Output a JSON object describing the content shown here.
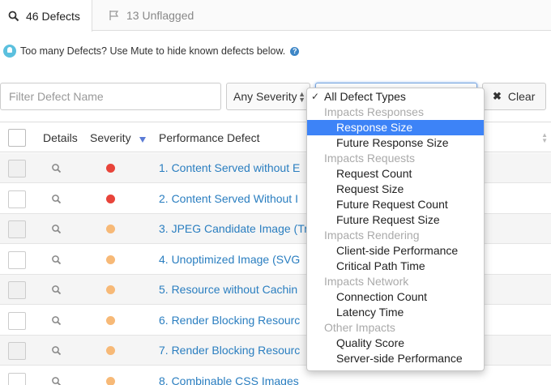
{
  "tabs": {
    "defects_label": "46 Defects",
    "unflagged_label": "13 Unflagged"
  },
  "info": {
    "message": "Too many Defects? Use Mute to hide known defects below.",
    "help_glyph": "?"
  },
  "filters": {
    "name_placeholder": "Filter Defect Name",
    "severity_value": "Any Severity",
    "clear_label": "Clear"
  },
  "table": {
    "headers": {
      "details": "Details",
      "severity": "Severity",
      "defect": "Performance Defect"
    },
    "rows": [
      {
        "name": "1.  Content Served without E",
        "severity_color": "#e8443a"
      },
      {
        "name": "2.  Content Served Without I",
        "severity_color": "#e8443a"
      },
      {
        "name": "3.  JPEG Candidate Image (Tr",
        "severity_color": "#f7b977"
      },
      {
        "name": "4.  Unoptimized Image (SVG",
        "severity_color": "#f7b977"
      },
      {
        "name": "5.  Resource without Cachin",
        "severity_color": "#f7b977"
      },
      {
        "name": "6.  Render Blocking Resourc",
        "severity_color": "#f7b977"
      },
      {
        "name": "7.  Render Blocking Resourc",
        "severity_color": "#f7b977"
      },
      {
        "name": "8.  Combinable CSS Images",
        "severity_color": "#f7b977"
      }
    ]
  },
  "dropdown": {
    "items": [
      {
        "kind": "selected",
        "label": "All Defect Types"
      },
      {
        "kind": "group",
        "label": "Impacts Responses"
      },
      {
        "kind": "option",
        "label": "Response Size",
        "highlighted": true
      },
      {
        "kind": "option",
        "label": "Future Response Size"
      },
      {
        "kind": "group",
        "label": "Impacts Requests"
      },
      {
        "kind": "option",
        "label": "Request Count"
      },
      {
        "kind": "option",
        "label": "Request Size"
      },
      {
        "kind": "option",
        "label": "Future Request Count"
      },
      {
        "kind": "option",
        "label": "Future Request Size"
      },
      {
        "kind": "group",
        "label": "Impacts Rendering"
      },
      {
        "kind": "option",
        "label": "Client-side Performance"
      },
      {
        "kind": "option",
        "label": "Critical Path Time"
      },
      {
        "kind": "group",
        "label": "Impacts Network"
      },
      {
        "kind": "option",
        "label": "Connection Count"
      },
      {
        "kind": "option",
        "label": "Latency Time"
      },
      {
        "kind": "group",
        "label": "Other Impacts"
      },
      {
        "kind": "option",
        "label": "Quality Score"
      },
      {
        "kind": "option",
        "label": "Server-side Performance"
      }
    ]
  },
  "colors": {
    "accent": "#2a7ec0",
    "highlight": "#3d83f7",
    "severity_high": "#e8443a",
    "severity_medium": "#f7b977"
  }
}
